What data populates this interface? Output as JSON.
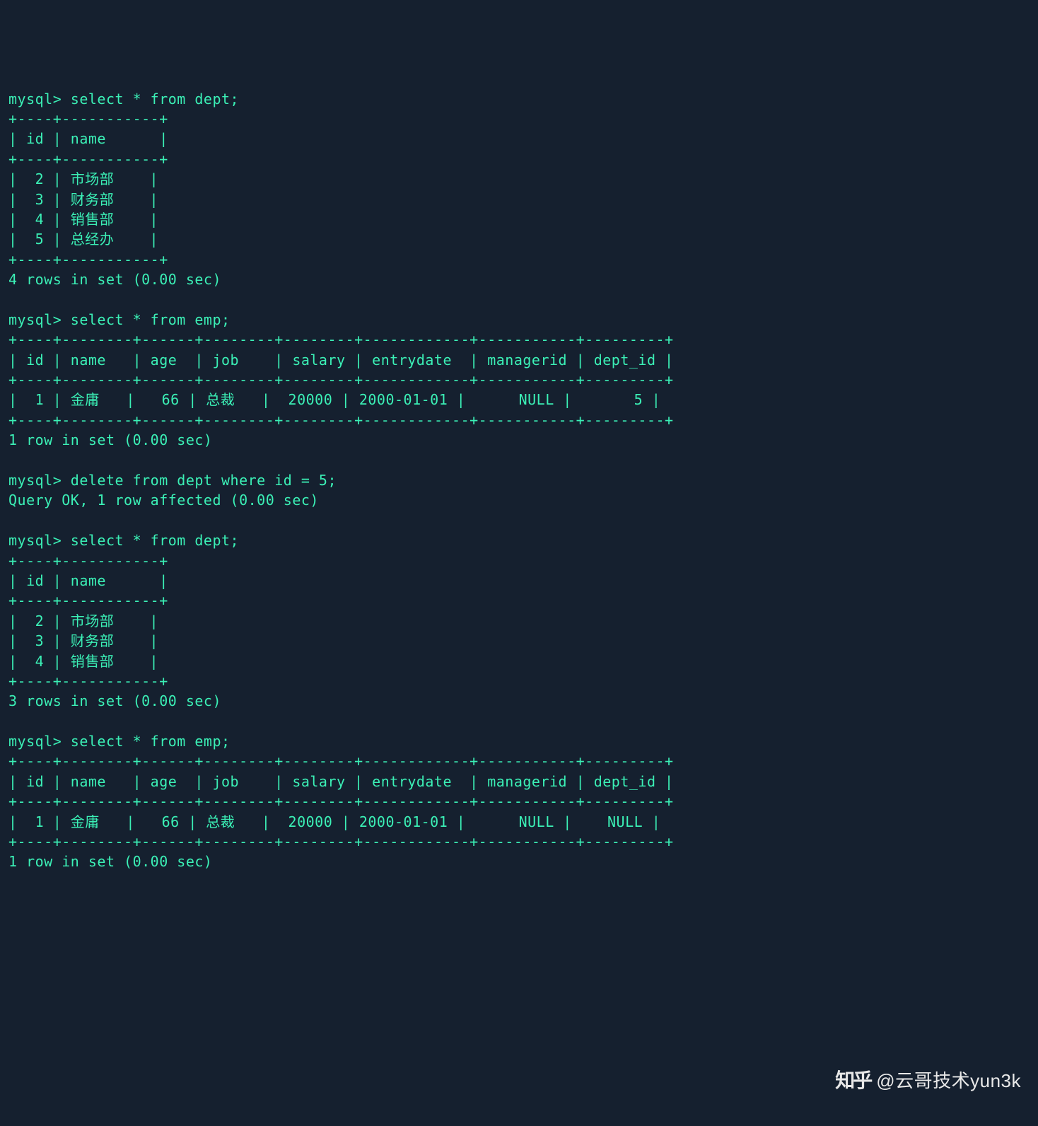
{
  "prompt": "mysql>",
  "blocks": [
    {
      "cmd": "select * from dept;",
      "table": {
        "sep": "+----+-----------+",
        "head": "| id | name      |",
        "rows": [
          "|  2 | 市场部    |",
          "|  3 | 财务部    |",
          "|  4 | 销售部    |",
          "|  5 | 总经办    |"
        ]
      },
      "status": "4 rows in set (0.00 sec)"
    },
    {
      "cmd": "select * from emp;",
      "table": {
        "sep": "+----+--------+------+--------+--------+------------+-----------+---------+",
        "head": "| id | name   | age  | job    | salary | entrydate  | managerid | dept_id |",
        "rows": [
          "|  1 | 金庸   |   66 | 总裁   |  20000 | 2000-01-01 |      NULL |       5 |"
        ]
      },
      "status": "1 row in set (0.00 sec)"
    },
    {
      "cmd": "delete from dept where id = 5;",
      "status": "Query OK, 1 row affected (0.00 sec)"
    },
    {
      "cmd": "select * from dept;",
      "table": {
        "sep": "+----+-----------+",
        "head": "| id | name      |",
        "rows": [
          "|  2 | 市场部    |",
          "|  3 | 财务部    |",
          "|  4 | 销售部    |"
        ]
      },
      "status": "3 rows in set (0.00 sec)"
    },
    {
      "cmd": "select * from emp;",
      "table": {
        "sep": "+----+--------+------+--------+--------+------------+-----------+---------+",
        "head": "| id | name   | age  | job    | salary | entrydate  | managerid | dept_id |",
        "rows": [
          "|  1 | 金庸   |   66 | 总裁   |  20000 | 2000-01-01 |      NULL |    NULL |"
        ]
      },
      "status": "1 row in set (0.00 sec)"
    }
  ],
  "watermark": {
    "logo": "知乎",
    "text": "@云哥技术yun3k"
  }
}
